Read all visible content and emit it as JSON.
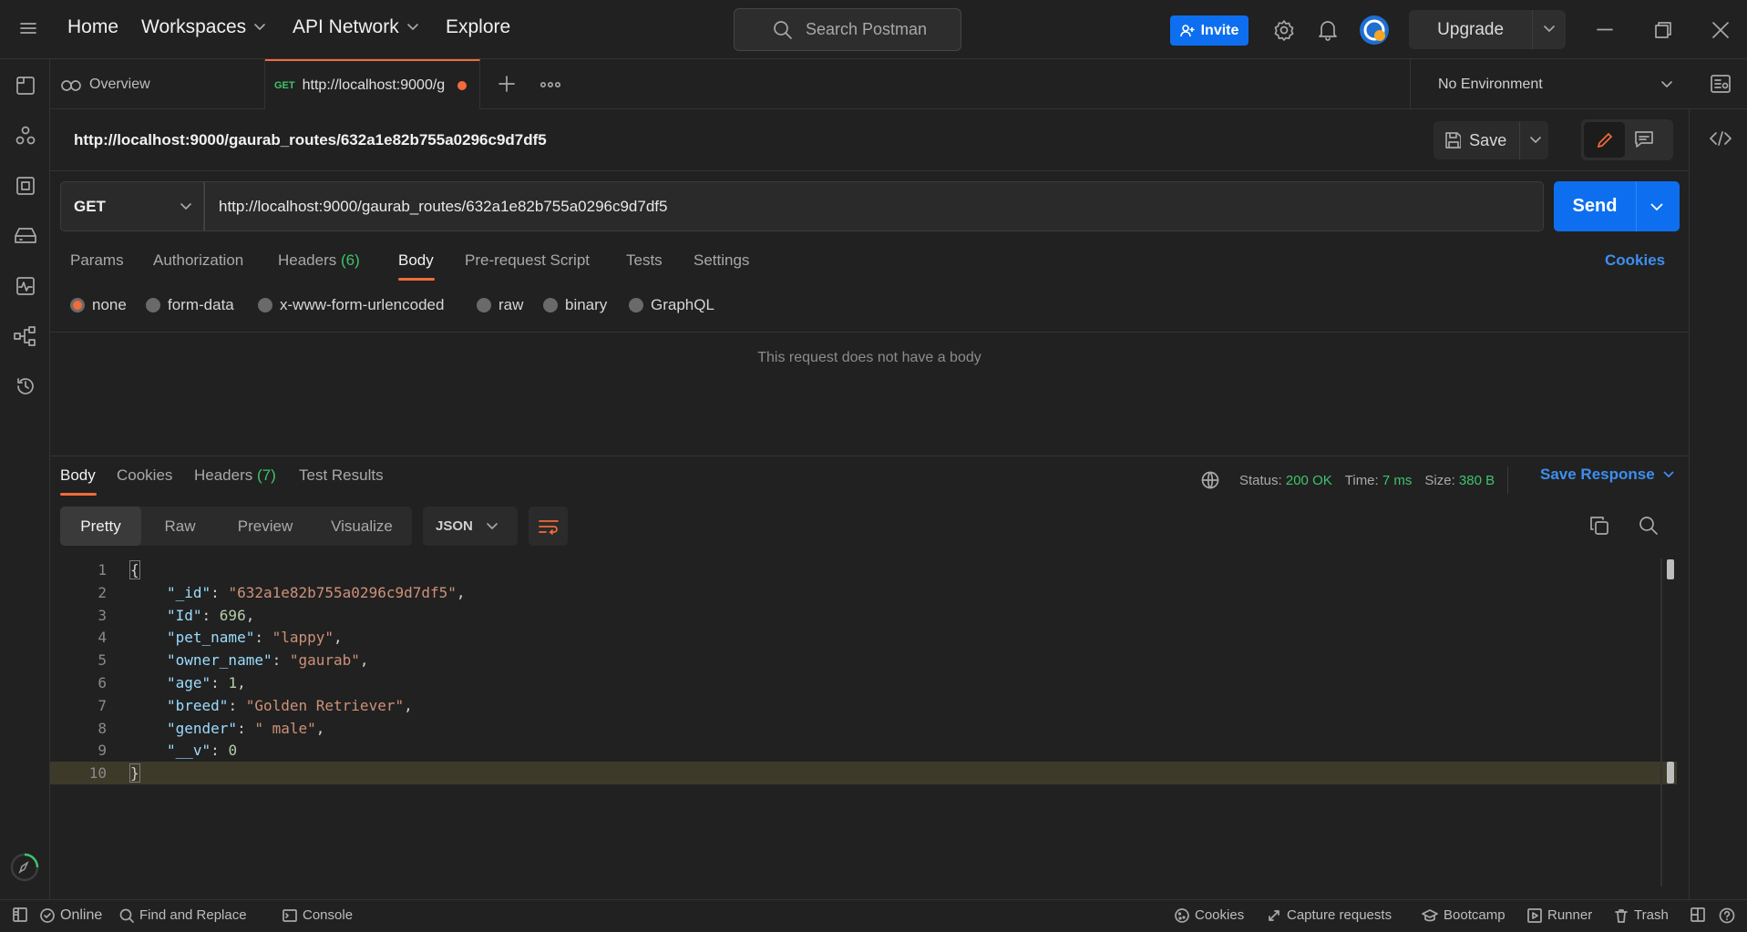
{
  "topbar": {
    "home": "Home",
    "workspaces": "Workspaces",
    "api_network": "API Network",
    "explore": "Explore",
    "search_placeholder": "Search Postman",
    "invite": "Invite",
    "upgrade": "Upgrade"
  },
  "tabs": {
    "overview": "Overview",
    "active_method": "GET",
    "active_url": "http://localhost:9000/g",
    "environment": "No Environment"
  },
  "request": {
    "title": "http://localhost:9000/gaurab_routes/632a1e82b755a0296c9d7df5",
    "save": "Save",
    "method": "GET",
    "url": "http://localhost:9000/gaurab_routes/632a1e82b755a0296c9d7df5",
    "send": "Send",
    "tabs": [
      "Params",
      "Authorization",
      "Headers",
      "Body",
      "Pre-request Script",
      "Tests",
      "Settings"
    ],
    "headers_count": "(6)",
    "cookies": "Cookies",
    "body_types": [
      "none",
      "form-data",
      "x-www-form-urlencoded",
      "raw",
      "binary",
      "GraphQL"
    ],
    "no_body": "This request does not have a body"
  },
  "response": {
    "tabs": [
      "Body",
      "Cookies",
      "Headers",
      "Test Results"
    ],
    "headers_count": "(7)",
    "status_label": "Status:",
    "status_value": "200 OK",
    "time_label": "Time:",
    "time_value": "7 ms",
    "size_label": "Size:",
    "size_value": "380 B",
    "save_response": "Save Response",
    "views": [
      "Pretty",
      "Raw",
      "Preview",
      "Visualize"
    ],
    "format": "JSON",
    "lines": [
      {
        "n": "1",
        "key": "",
        "sep": "",
        "val": "",
        "raw": "{"
      },
      {
        "n": "2",
        "key": "\"_id\"",
        "sep": ": ",
        "val": "\"632a1e82b755a0296c9d7df5\"",
        "type": "s",
        "end": ","
      },
      {
        "n": "3",
        "key": "\"Id\"",
        "sep": ": ",
        "val": "696",
        "type": "n",
        "end": ","
      },
      {
        "n": "4",
        "key": "\"pet_name\"",
        "sep": ": ",
        "val": "\"lappy\"",
        "type": "s",
        "end": ","
      },
      {
        "n": "5",
        "key": "\"owner_name\"",
        "sep": ": ",
        "val": "\"gaurab\"",
        "type": "s",
        "end": ","
      },
      {
        "n": "6",
        "key": "\"age\"",
        "sep": ": ",
        "val": "1",
        "type": "n",
        "end": ","
      },
      {
        "n": "7",
        "key": "\"breed\"",
        "sep": ": ",
        "val": "\"Golden Retriever\"",
        "type": "s",
        "end": ","
      },
      {
        "n": "8",
        "key": "\"gender\"",
        "sep": ": ",
        "val": "\" male\"",
        "type": "s",
        "end": ","
      },
      {
        "n": "9",
        "key": "\"__v\"",
        "sep": ": ",
        "val": "0",
        "type": "n",
        "end": ""
      },
      {
        "n": "10",
        "key": "",
        "sep": "",
        "val": "",
        "raw": "}"
      }
    ]
  },
  "statusbar": {
    "online": "Online",
    "find_replace": "Find and Replace",
    "console": "Console",
    "cookies": "Cookies",
    "capture": "Capture requests",
    "bootcamp": "Bootcamp",
    "runner": "Runner",
    "trash": "Trash"
  },
  "colors": {
    "accent_orange": "#f26b3a",
    "primary_blue": "#0d6ff0",
    "success_green": "#3fc36b"
  }
}
